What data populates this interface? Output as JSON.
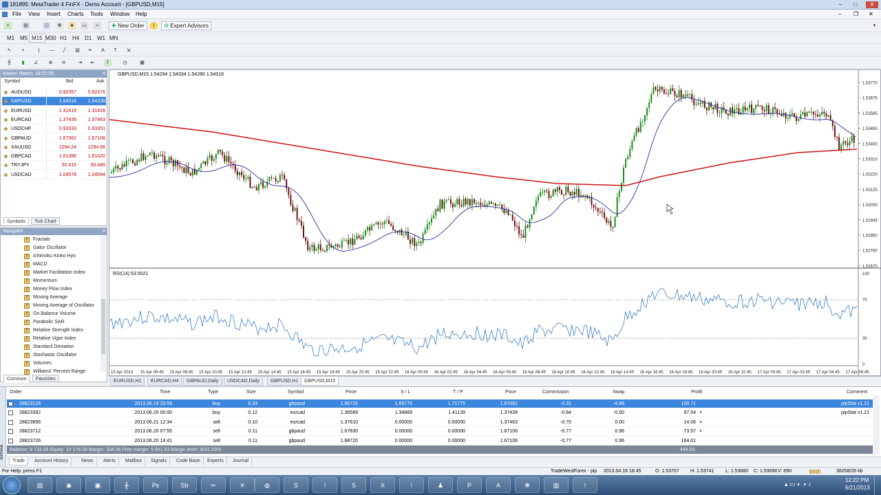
{
  "window": {
    "title": "181895: MetaTrader 4 FinFX - Demo Account - [GBPUSD,M15]"
  },
  "menu": [
    "File",
    "View",
    "Insert",
    "Charts",
    "Tools",
    "Window",
    "Help"
  ],
  "toolbar": {
    "new_order": "New Order",
    "expert_advisors": "Expert Advisors"
  },
  "timeframes": [
    "M1",
    "M5",
    "M15",
    "M30",
    "H1",
    "H4",
    "D1",
    "W1",
    "MN"
  ],
  "market_watch": {
    "title": "Market Watch: 18:22:35",
    "headers": [
      "Symbol",
      "Bid",
      "Ask"
    ],
    "rows": [
      {
        "symbol": "AUDUSD",
        "bid": "0.92357",
        "ask": "0.92376"
      },
      {
        "symbol": "GBPUSD",
        "bid": "1.54316",
        "ask": "1.54338"
      },
      {
        "symbol": "EURUSD",
        "bid": "1.31419",
        "ask": "1.31426"
      },
      {
        "symbol": "EURCAD",
        "bid": "1.37439",
        "ask": "1.37463"
      },
      {
        "symbol": "USDCHF",
        "bid": "0.93333",
        "ask": "0.93351"
      },
      {
        "symbol": "GBPAUD",
        "bid": "1.67062",
        "ask": "1.67106"
      },
      {
        "symbol": "XAUUSD",
        "bid": "1294.24",
        "ask": "1294.66"
      },
      {
        "symbol": "GBPCAD",
        "bid": "1.61386",
        "ask": "1.61420"
      },
      {
        "symbol": "TRYJPY",
        "bid": "50.415",
        "ask": "50.480"
      },
      {
        "symbol": "USDCAD",
        "bid": "1.04578",
        "ask": "1.04594"
      }
    ],
    "tabs": [
      "Symbols",
      "Tick Chart"
    ]
  },
  "navigator": {
    "title": "Navigator",
    "items": [
      "Fractals",
      "Gator Oscillator",
      "Ichimoku Kinko Hyo",
      "MACD",
      "Market Facilitation Index",
      "Momentum",
      "Money Flow Index",
      "Moving Average",
      "Moving Average of Oscillator",
      "On Balance Volume",
      "Parabolic SAR",
      "Relative Strength Index",
      "Relative Vigor Index",
      "Standard Deviation",
      "Stochastic Oscillator",
      "Volumes",
      "Williams' Percent Range"
    ],
    "tabs": [
      "Common",
      "Favorites"
    ]
  },
  "chart": {
    "header": "GBPUSD,M15  1.54294 1.54334 1.54280 1.54316",
    "rsi_label": "RSI(14) 53.5021",
    "price_ticks": [
      "1.53770",
      "1.53675",
      "1.53585",
      "1.53495",
      "1.53400",
      "1.53310",
      "1.53220",
      "1.53125",
      "1.53035",
      "1.52945",
      "1.52850",
      "1.52760",
      "1.52670"
    ],
    "rsi_ticks": [
      "100",
      "70",
      "30",
      "0"
    ],
    "time_ticks": [
      "15 Apr 2013",
      "15 Apr 06:45",
      "15 Apr 08:45",
      "15 Apr 10:45",
      "15 Apr 12:45",
      "15 Apr 14:45",
      "15 Apr 16:45",
      "15 Apr 18:45",
      "15 Apr 20:45",
      "15 Apr 22:45",
      "16 Apr 00:45",
      "16 Apr 02:45",
      "16 Apr 04:45",
      "16 Apr 06:45",
      "16 Apr 08:45",
      "16 Apr 10:45",
      "16 Apr 12:45",
      "16 Apr 14:45",
      "16 Apr 16:45",
      "16 Apr 18:45",
      "16 Apr 20:45",
      "16 Apr 22:45",
      "17 Apr 00:45",
      "17 Apr 02:45",
      "17 Apr 04:45",
      "17 Apr 06:45"
    ],
    "tabs": [
      "EURUSD,H1",
      "EURCAD,H4",
      "GBPAUD,Daily",
      "USDCAD,Daily",
      "GBPUSD,H1",
      "GBPUSD,M15"
    ],
    "colors": {
      "ma_slow": "#cc1111",
      "ma_fast": "#2b2b9e",
      "rsi": "#3b7fc4",
      "bull": "#1a8a1a",
      "bear": "#6b1111"
    }
  },
  "terminal": {
    "headers": [
      "Order",
      "Time",
      "Type",
      "Size",
      "Symbol",
      "Price",
      "S / L",
      "T / P",
      "Price",
      "Commission",
      "Swap",
      "Profit",
      "Comment"
    ],
    "rows": [
      [
        "28823126",
        "2013.06.19 23:59",
        "buy",
        "0.33",
        "gbpaud",
        "1.66725",
        "1.65775",
        "1.71775",
        "1.67062",
        "-2.31",
        "-4.89",
        "100.71",
        "pipStat v1.21"
      ],
      [
        "28823392",
        "2013.06.20 00:00",
        "buy",
        "0.12",
        "eurcad",
        "1.36589",
        "1.34889",
        "1.41139",
        "1.37439",
        "-0.84",
        "-0.50",
        "97.54",
        "pipStat v1.21"
      ],
      [
        "28823656",
        "2013.06.21 12:34",
        "sell",
        "0.10",
        "eurcad",
        "1.37610",
        "0.00000",
        "0.00000",
        "1.37463",
        "-0.70",
        "0.00",
        "14.06",
        ""
      ],
      [
        "28823712",
        "2013.06.20 07:55",
        "sell",
        "0.11",
        "gbpaud",
        "1.67830",
        "0.00000",
        "0.00000",
        "1.67106",
        "-0.77",
        "0.96",
        "73.57",
        ""
      ],
      [
        "28823726",
        "2013.06.20 14:41",
        "sell",
        "0.11",
        "gbpaud",
        "1.68720",
        "0.00000",
        "0.00000",
        "1.67106",
        "-0.77",
        "0.96",
        "164.01",
        ""
      ]
    ],
    "balance": "Balance: 9 733.08  Equity: 10 176.09  Margin: 334.56  Free margin: 9 841.53  Margin level: 3041.59%",
    "total_profit": "449.03",
    "tabs": [
      "Trade",
      "Account History",
      "News",
      "Alerts",
      "Mailbox",
      "Signals",
      "Code Base",
      "Experts",
      "Journal"
    ],
    "side_label": "Terminal"
  },
  "status": {
    "help": "For Help, press F1",
    "profile": "TradeWestForex - pip",
    "datetime": "2013.04.16 18:45",
    "open": "O: 1.53707",
    "high": "H: 1.53741",
    "low": "L: 1.53680",
    "close": "C: 1.53696",
    "volume": "V: 890",
    "traffic": "38258/26 kb"
  },
  "taskbar": {
    "time": "12:22 PM",
    "date": "6/21/2013"
  }
}
